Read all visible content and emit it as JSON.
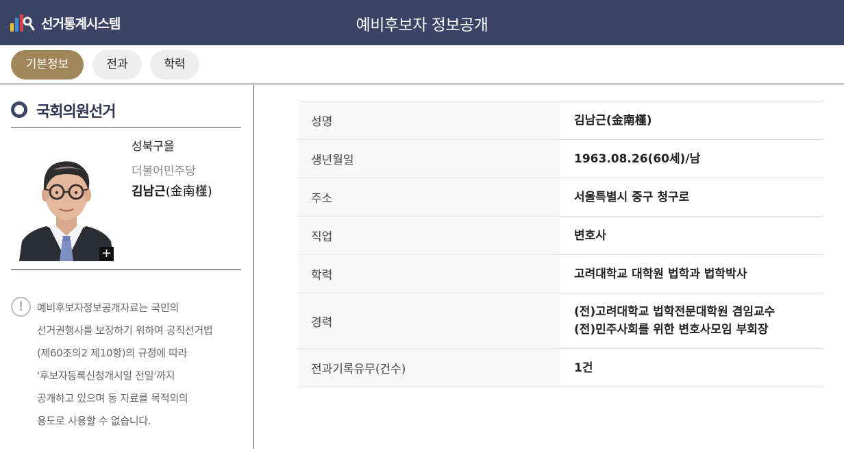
{
  "header": {
    "logo_text": "선거통계시스템",
    "page_title": "예비후보자 정보공개"
  },
  "tabs": [
    {
      "label": "기본정보",
      "active": true
    },
    {
      "label": "전과",
      "active": false
    },
    {
      "label": "학력",
      "active": false
    }
  ],
  "sidebar": {
    "section_title": "국회의원선거",
    "district": "성북구을",
    "party": "더불어민주당",
    "name": "김남근",
    "name_hanja": "(金南槿)",
    "photo_enlarge_label": "+",
    "notice_icon": "!",
    "notice_lines": [
      "예비후보자정보공개자료는 국민의",
      "선거권행사를 보장하기 위하여 공직선거법",
      "(제60조의2 제10항)의 규정에 따라",
      "'후보자등록신청개시일 전일'까지",
      "공개하고 있으며 동 자료를 목적외의",
      "용도로 사용할 수 없습니다."
    ]
  },
  "info": {
    "rows": [
      {
        "label": "성명",
        "value": [
          "김남근(金南槿)"
        ]
      },
      {
        "label": "생년월일",
        "value": [
          "1963.08.26(60세)/남"
        ]
      },
      {
        "label": "주소",
        "value": [
          "서울특별시 중구 청구로"
        ]
      },
      {
        "label": "직업",
        "value": [
          "변호사"
        ]
      },
      {
        "label": "학력",
        "value": [
          "고려대학교 대학원 법학과 법학박사"
        ]
      },
      {
        "label": "경력",
        "value": [
          "(전)고려대학교 법학전문대학원 겸임교수",
          "(전)민주사회를 위한 변호사모임 부회장"
        ]
      },
      {
        "label": "전과기록유무(건수)",
        "value": [
          "1건"
        ]
      }
    ]
  },
  "colors": {
    "header_bg": "#3b4466",
    "active_tab": "#a08658",
    "inactive_tab": "#eeeeee"
  }
}
